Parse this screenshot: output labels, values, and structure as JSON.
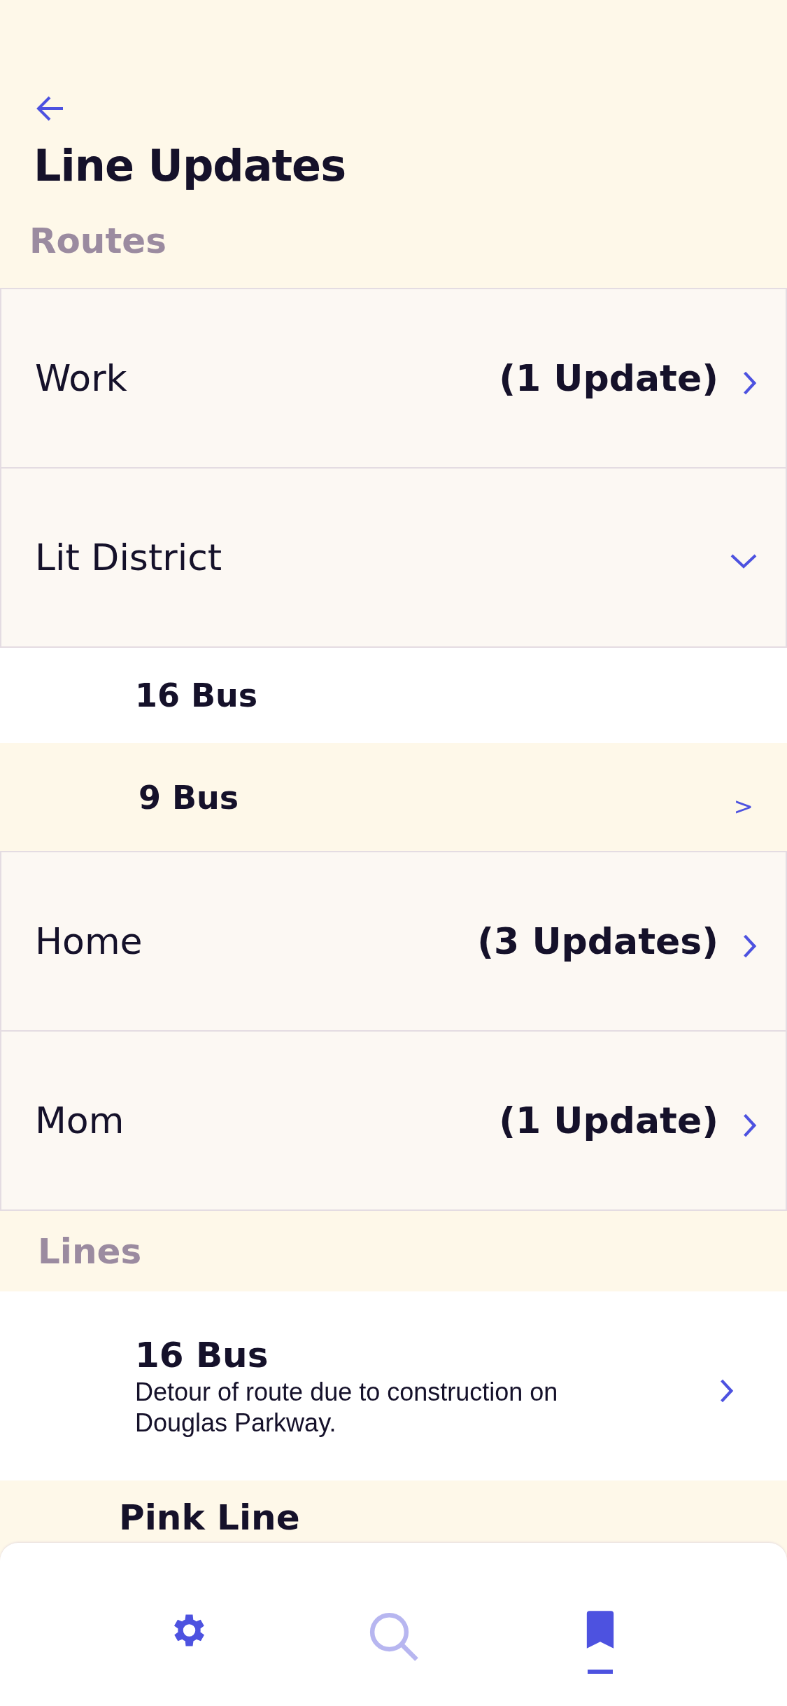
{
  "header": {
    "title": "Line Updates"
  },
  "routes": {
    "heading": "Routes",
    "items": [
      {
        "name": "Work",
        "updates": "(1 Update)",
        "expanded": false
      },
      {
        "name": "Lit District",
        "expanded": true,
        "children": [
          {
            "name": "16 Bus"
          },
          {
            "name": "9 Bus",
            "chevron": ">"
          }
        ]
      },
      {
        "name": "Home",
        "updates": "(3 Updates)",
        "expanded": false
      },
      {
        "name": "Mom",
        "updates": "(1 Update)",
        "expanded": false
      }
    ]
  },
  "lines": {
    "heading": "Lines",
    "items": [
      {
        "name": "16 Bus",
        "description": "Detour of route due to construction on Douglas Parkway.",
        "chevron": true
      },
      {
        "name": "Pink Line",
        "chevron": false
      }
    ]
  },
  "nav": [
    {
      "kind": "settings",
      "selected": false,
      "dimmed": false
    },
    {
      "kind": "search",
      "selected": false,
      "dimmed": true
    },
    {
      "kind": "bookmark",
      "selected": true,
      "dimmed": false
    }
  ]
}
